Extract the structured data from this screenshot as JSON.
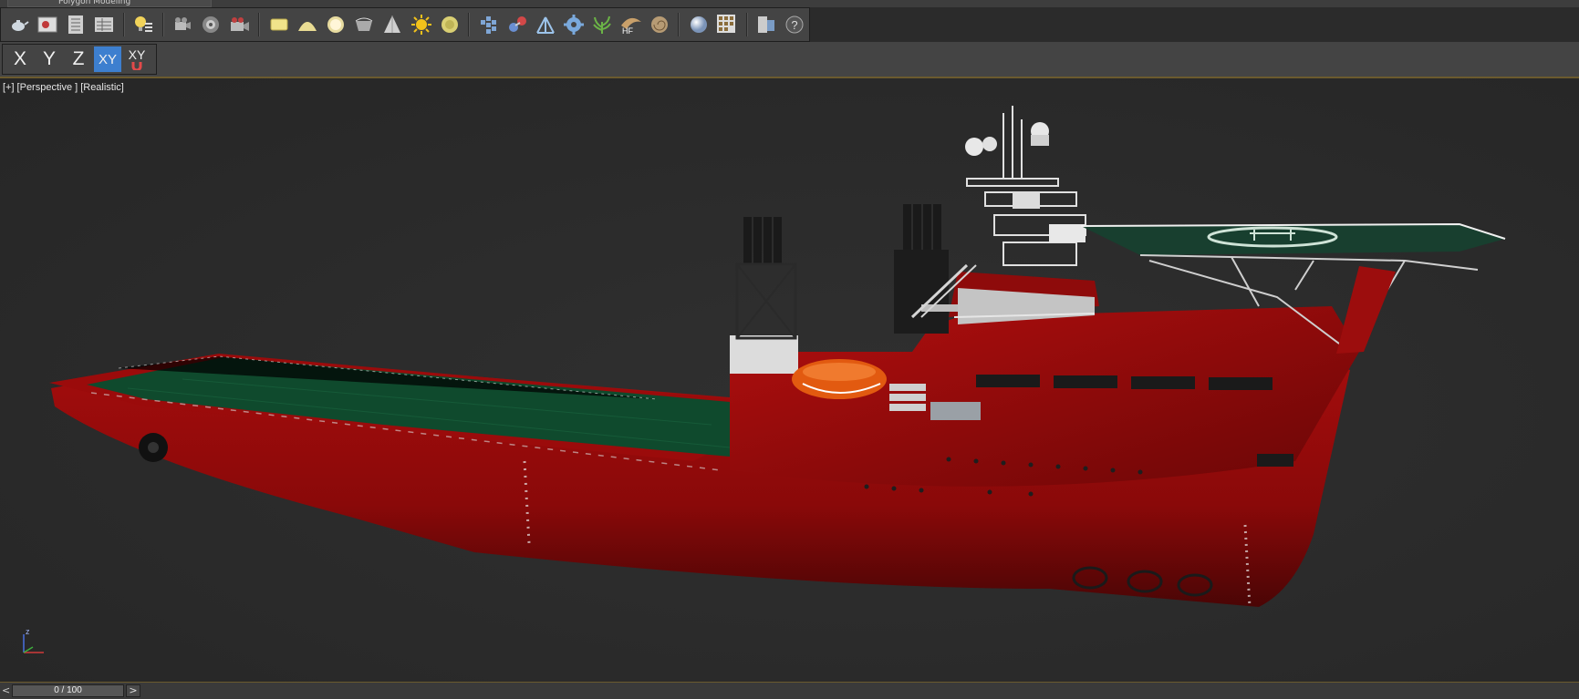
{
  "app": {
    "ribbon_tab": "Polygon Modeling"
  },
  "toolbar": {
    "icons": [
      "teapot-render-icon",
      "render-frame-icon",
      "render-setup-icon",
      "render-queue-icon",
      "light-lister-icon",
      "camera-icon",
      "camera-target-icon",
      "camera-record-icon",
      "plane-icon",
      "dome-icon",
      "sphere-icon",
      "pot-icon",
      "cone-icon",
      "sun-icon",
      "disc-icon",
      "mesh-grid-icon",
      "molecule-icon",
      "tripod-icon",
      "gear-cluster-icon",
      "plant-icon",
      "hair-fur-icon",
      "shell-icon",
      "material-sphere-icon",
      "material-grid-icon",
      "panel-icon",
      "help-icon"
    ],
    "hf_label": "HF",
    "help_label": "?"
  },
  "axis_constraints": {
    "x": "X",
    "y": "Y",
    "z": "Z",
    "xy": "XY",
    "xy_snap": "XY"
  },
  "viewport": {
    "label_plus": "[+]",
    "label_view": "[Perspective ]",
    "label_shading": "[Realistic]"
  },
  "gizmo": {
    "z_label": "z"
  },
  "timeline": {
    "frame": "0 / 100",
    "prev": "<",
    "next": ">"
  },
  "colors": {
    "hull": "#9a0c0c",
    "deck": "#0f4a2d",
    "ui_bg": "#444444",
    "active": "#3d7fcf"
  }
}
